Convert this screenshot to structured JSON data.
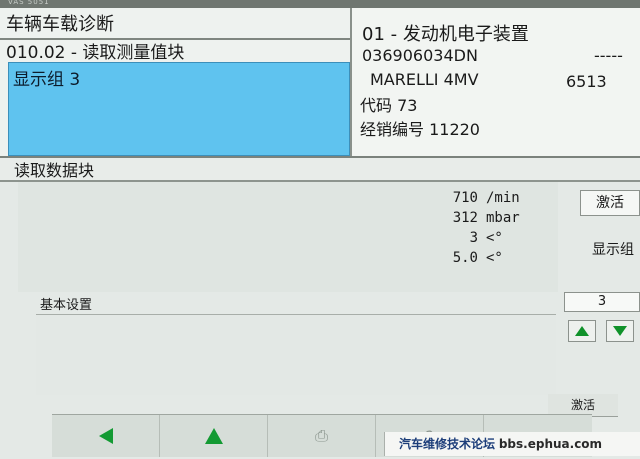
{
  "header": {
    "app_title": "车辆车载诊断",
    "function_title": "010.02 - 读取测量值块",
    "selected_item": "显示组 3"
  },
  "ecu": {
    "line1": "01 - 发动机电子装置",
    "part_number": "036906034DN",
    "dashes": "-----",
    "model": "MARELLI 4MV",
    "model_code": "6513",
    "code_line": "代码 73",
    "dealer_line": "经销编号 11220"
  },
  "section": {
    "title": "读取数据块"
  },
  "values": [
    {
      "num": "710",
      "unit": "/min"
    },
    {
      "num": "312",
      "unit": "mbar"
    },
    {
      "num": "3",
      "unit": "<°"
    },
    {
      "num": "5.0",
      "unit": "<°"
    }
  ],
  "basic_setting": {
    "label": "基本设置"
  },
  "controls": {
    "activate": "激活",
    "display_group": "显示组",
    "group_number": "3",
    "activate_small": "激活"
  },
  "toolbar": {
    "icons": [
      "back-arrow-icon",
      "up-arrow-icon",
      "print-icon",
      "help-icon",
      "forward-icon"
    ]
  },
  "watermark": {
    "text_cn": "汽车维修技术论坛",
    "url": "bbs.ephua.com"
  },
  "colors": {
    "selection": "#5fc3ef",
    "arrow_green": "#139a33"
  }
}
